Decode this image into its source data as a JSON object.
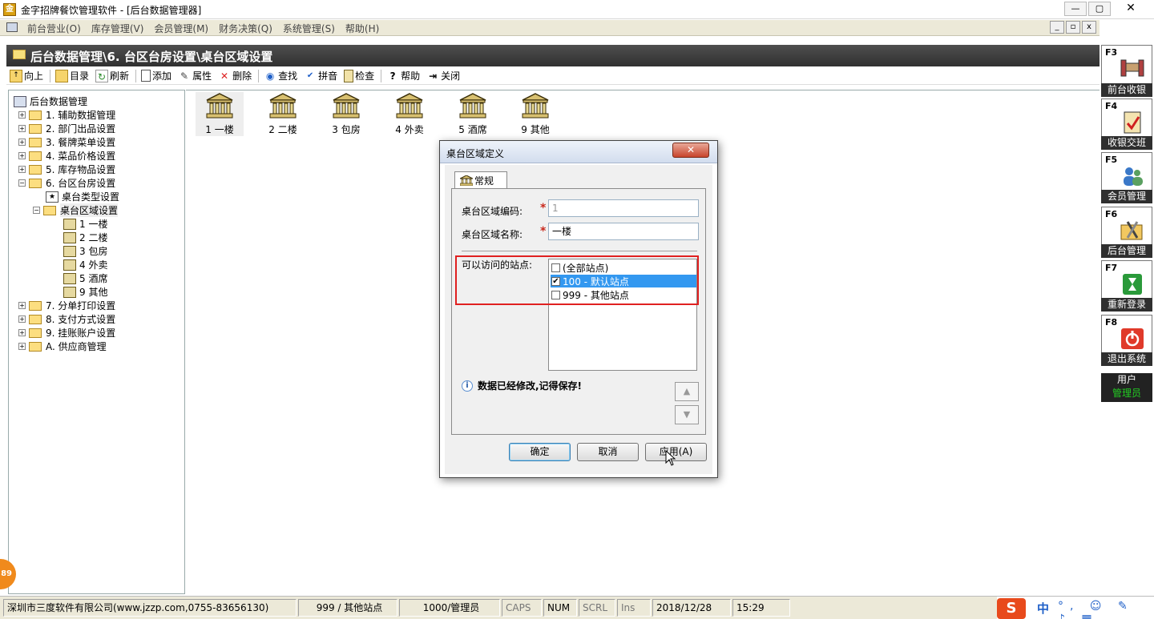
{
  "window": {
    "title": "金字招牌餐饮管理软件 - [后台数据管理器]",
    "min": "—",
    "max": "▢",
    "close": "✕"
  },
  "menu": [
    "前台营业(O)",
    "库存管理(V)",
    "会员管理(M)",
    "财务决策(Q)",
    "系统管理(S)",
    "帮助(H)"
  ],
  "mdi": {
    "min": "_",
    "restore": "▫",
    "close": "x"
  },
  "path": "后台数据管理\\6. 台区台房设置\\桌台区域设置",
  "toolbar": {
    "up": "向上",
    "dir": "目录",
    "refresh": "刷新",
    "add": "添加",
    "props": "属性",
    "delete": "删除",
    "find": "查找",
    "pinyin": "拼音",
    "check": "检查",
    "help": "帮助",
    "close": "关闭"
  },
  "tree": {
    "root": "后台数据管理",
    "items": [
      "1. 辅助数据管理",
      "2. 部门出品设置",
      "3. 餐牌菜单设置",
      "4. 菜品价格设置",
      "5. 库存物品设置",
      "6. 台区台房设置"
    ],
    "sub": [
      "桌台类型设置",
      "桌台区域设置"
    ],
    "zones": [
      "1 一楼",
      "2 二楼",
      "3 包房",
      "4 外卖",
      "5 酒席",
      "9 其他"
    ],
    "after": [
      "7. 分单打印设置",
      "8. 支付方式设置",
      "9. 挂账账户设置",
      "A. 供应商管理"
    ]
  },
  "zones": [
    "1 一楼",
    "2 二楼",
    "3 包房",
    "4 外卖",
    "5 酒席",
    "9 其他"
  ],
  "side": {
    "f3": {
      "key": "F3",
      "label": "前台收银"
    },
    "f4": {
      "key": "F4",
      "label": "收银交班"
    },
    "f5": {
      "key": "F5",
      "label": "会员管理"
    },
    "f6": {
      "key": "F6",
      "label": "后台管理"
    },
    "f7": {
      "key": "F7",
      "label": "重新登录"
    },
    "f8": {
      "key": "F8",
      "label": "退出系统"
    },
    "user_label": "用户",
    "user_name": "管理员"
  },
  "dialog": {
    "title": "桌台区域定义",
    "tab": "常规",
    "code_label": "桌台区域编码:",
    "code_value": "1",
    "name_label": "桌台区域名称:",
    "name_value": "一楼",
    "sites_label": "可以访问的站点:",
    "sites": [
      {
        "label": "(全部站点)",
        "checked": false
      },
      {
        "label": "100 - 默认站点",
        "checked": true
      },
      {
        "label": "999 - 其他站点",
        "checked": false
      }
    ],
    "message": "数据已经修改,记得保存!",
    "ok": "确定",
    "cancel": "取消",
    "apply": "应用(A)"
  },
  "status": {
    "company": "深圳市三度软件有限公司(www.jzzp.com,0755-83656130)",
    "site": "999 / 其他站点",
    "user": "1000/管理员",
    "caps": "CAPS",
    "num": "NUM",
    "scrl": "SCRL",
    "ins": "Ins",
    "date": "2018/12/28",
    "time": "15:29",
    "badge": "89",
    "ime_zh": "中"
  },
  "colors": {
    "path_bg": "#3c3c3c",
    "side_label_bg": "#2f2f2f",
    "user_name": "#22cc22",
    "selection": "#3398f0",
    "highlight_box": "#e02020"
  }
}
